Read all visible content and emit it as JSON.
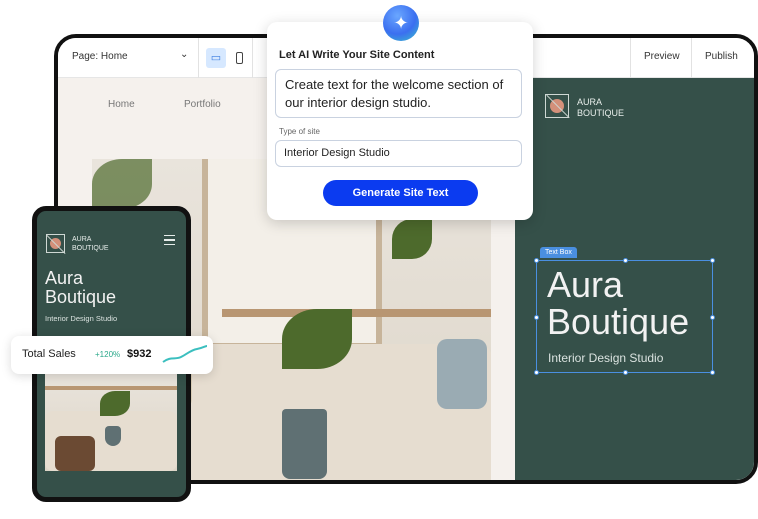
{
  "editor": {
    "page_selector": "Page: Home",
    "preview_label": "Preview",
    "publish_label": "Publish",
    "nav": [
      "Home",
      "Portfolio"
    ]
  },
  "site": {
    "logo_line1": "AURA",
    "logo_line2": "BOUTIQUE",
    "title_line1": "Aura",
    "title_line2": "Boutique",
    "subtitle": "Interior Design Studio",
    "textbox_label": "Text Box"
  },
  "ai_panel": {
    "title": "Let AI Write Your Site Content",
    "prompt": "Create text for the welcome section of our interior design studio.",
    "type_label": "Type of site",
    "type_value": "Interior Design Studio",
    "button": "Generate Site Text"
  },
  "sales": {
    "label": "Total Sales",
    "change": "+120%",
    "value": "$932"
  },
  "colors": {
    "panel_green": "#355049",
    "accent_blue": "#0b3bf0",
    "selection": "#4a8fe0",
    "trend": "#3bbfbf"
  }
}
